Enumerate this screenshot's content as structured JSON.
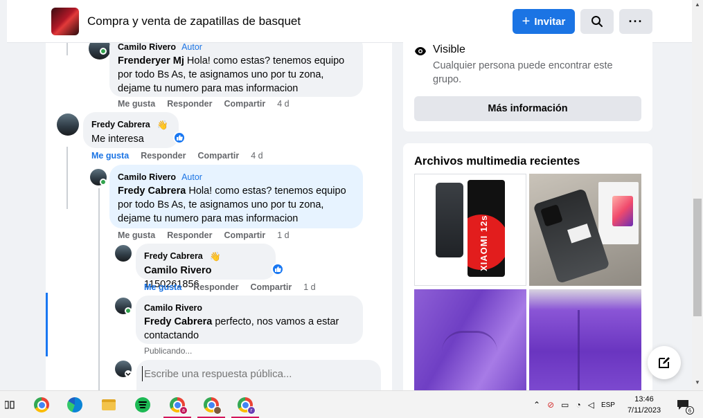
{
  "header": {
    "group_title": "Compra y venta de zapatillas de basquet",
    "invite_label": "Invitar",
    "more_label": "···"
  },
  "comments": [
    {
      "author": "Camilo Rivero",
      "author_tag": "Autor",
      "mention": "Frenderyer Mj",
      "text": " Hola! como estas? tenemos equipo por todo Bs As, te asignamos uno por tu zona, dejame tu numero para mas informacion",
      "actions": [
        "Me gusta",
        "Responder",
        "Compartir"
      ],
      "time": "4 d"
    },
    {
      "author": "Fredy Cabrera",
      "text": "Me interesa",
      "actions": [
        "Me gusta",
        "Responder",
        "Compartir"
      ],
      "time": "4 d"
    },
    {
      "author": "Camilo Rivero",
      "author_tag": "Autor",
      "mention": "Fredy Cabrera",
      "text": " Hola! como estas? tenemos equipo por todo Bs As, te asignamos uno por tu zona, dejame tu numero para mas informacion",
      "actions": [
        "Me gusta",
        "Responder",
        "Compartir"
      ],
      "time": "1 d"
    },
    {
      "author": "Fredy Cabrera",
      "mention": "Camilo Rivero",
      "text": " 1150261856",
      "actions": [
        "Me gusta",
        "Responder",
        "Compartir"
      ],
      "time": "1 d"
    },
    {
      "author": "Camilo Rivero",
      "mention": "Fredy Cabrera",
      "text": " perfecto, nos vamos a estar contactando",
      "status": "Publicando..."
    }
  ],
  "reply": {
    "placeholder": "Escribe una respuesta pública..."
  },
  "about": {
    "visibility_title": "Visible",
    "visibility_desc": "Cualquier persona puede encontrar este grupo.",
    "more_info_label": "Más información"
  },
  "media": {
    "title": "Archivos multimedia recientes",
    "phone_label": "XIAOMI 12s"
  },
  "taskbar": {
    "language": "ESP",
    "time": "13:46",
    "date": "7/11/2023",
    "notifications": "6",
    "profile_letters": [
      "a",
      "",
      "r"
    ]
  },
  "colors": {
    "facebook_blue": "#1b74e4",
    "online_green": "#31a24c",
    "comment_bubble": "#f0f2f5",
    "author_bubble": "#e7f3ff"
  }
}
